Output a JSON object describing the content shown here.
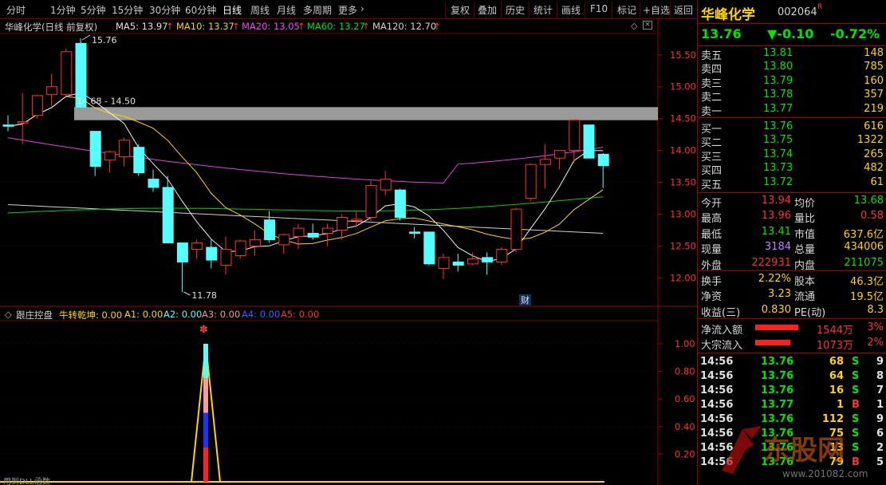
{
  "toolbar": {
    "periods": [
      "分时",
      "1分钟",
      "5分钟",
      "15分钟",
      "30分钟",
      "60分钟",
      "日线",
      "周线",
      "月线",
      "多周期",
      "更多"
    ],
    "active": "日线",
    "actions": [
      "复权",
      "叠加",
      "历史",
      "统计",
      "画线",
      "F10",
      "标记",
      "+自选",
      "返回"
    ]
  },
  "chart_info": {
    "title": "华峰化学(日线 前复权)",
    "ma5": "MA5: 13.97",
    "ma10": "MA10: 13.37",
    "ma20": "MA20: 13.05",
    "ma60": "MA60: 13.27",
    "ma120": "MA120: 12.70",
    "arrow": "↑"
  },
  "price_axis": [
    "15.50",
    "15.00",
    "14.50",
    "14.00",
    "13.50",
    "13.00",
    "12.50",
    "12.00"
  ],
  "annotations": {
    "high": "15.76",
    "low": "11.78",
    "zone": "14.68 - 14.50",
    "fin": "财"
  },
  "indicator": {
    "name": "跟庄控盘",
    "line_name": "牛转乾坤: 0.00",
    "a1": "A1: 0.00",
    "a2": "A2: 0.00",
    "a3": "A3: 0.00",
    "a4": "A4: 0.00",
    "a5": "A5: 0.00",
    "axis": [
      "1.00",
      "0.80",
      "0.60",
      "0.40",
      "0.20"
    ]
  },
  "bottom_text": "用到DLL函数",
  "stock": {
    "name": "华峰化学",
    "code": "002064",
    "flag": "R",
    "price": "13.76",
    "change": "▼-0.10",
    "pct": "-0.72%"
  },
  "asks": [
    {
      "label": "卖五",
      "price": "13.81",
      "vol": "148"
    },
    {
      "label": "卖四",
      "price": "13.80",
      "vol": "785"
    },
    {
      "label": "卖三",
      "price": "13.79",
      "vol": "160"
    },
    {
      "label": "卖二",
      "price": "13.78",
      "vol": "357"
    },
    {
      "label": "卖一",
      "price": "13.77",
      "vol": "219"
    }
  ],
  "bids": [
    {
      "label": "买一",
      "price": "13.76",
      "vol": "616"
    },
    {
      "label": "买二",
      "price": "13.75",
      "vol": "1322"
    },
    {
      "label": "买三",
      "price": "13.74",
      "vol": "265"
    },
    {
      "label": "买四",
      "price": "13.73",
      "vol": "482"
    },
    {
      "label": "买五",
      "price": "13.72",
      "vol": "61"
    }
  ],
  "quote": [
    {
      "l1": "今开",
      "v1": "13.94",
      "l2": "均价",
      "v2": "13.68"
    },
    {
      "l1": "最高",
      "v1": "13.96",
      "l2": "量比",
      "v2": "0.58"
    },
    {
      "l1": "最低",
      "v1": "13.41",
      "l2": "市值",
      "v2": "637.6亿"
    },
    {
      "l1": "现量",
      "v1": "3184",
      "l2": "总量",
      "v2": "434006"
    },
    {
      "l1": "外盘",
      "v1": "222931",
      "l2": "内盘",
      "v2": "211075"
    }
  ],
  "quote2": [
    {
      "l1": "换手",
      "v1": "2.22%",
      "l2": "股本",
      "v2": "46.3亿"
    },
    {
      "l1": "净资",
      "v1": "3.23",
      "l2": "流通",
      "v2": "19.5亿"
    },
    {
      "l1": "收益(三)",
      "v1": "0.830",
      "l2": "PE(动)",
      "v2": "8.3"
    }
  ],
  "flows": [
    {
      "label": "净流入额",
      "value": "1544万",
      "pct": "3%"
    },
    {
      "label": "大宗流入",
      "value": "1073万",
      "pct": "2%"
    }
  ],
  "ticks": [
    {
      "time": "14:56",
      "price": "13.76",
      "vol": "68",
      "bs": "S",
      "n": "9"
    },
    {
      "time": "14:56",
      "price": "13.76",
      "vol": "64",
      "bs": "S",
      "n": "8"
    },
    {
      "time": "14:56",
      "price": "13.76",
      "vol": "16",
      "bs": "S",
      "n": "7"
    },
    {
      "time": "14:56",
      "price": "13.77",
      "vol": "1",
      "bs": "B",
      "n": "1"
    },
    {
      "time": "14:56",
      "price": "13.76",
      "vol": "112",
      "bs": "S",
      "n": "9"
    },
    {
      "time": "14:56",
      "price": "13.76",
      "vol": "75",
      "bs": "S",
      "n": "6"
    },
    {
      "time": "14:56",
      "price": "13.76",
      "vol": "13",
      "bs": "S",
      "n": "2"
    },
    {
      "time": "14:56",
      "price": "13.76",
      "vol": "79",
      "bs": "B",
      "n": "5"
    }
  ],
  "candles": [
    {
      "o": 14.4,
      "h": 14.55,
      "l": 14.3,
      "c": 14.38
    },
    {
      "o": 14.45,
      "h": 14.9,
      "l": 14.1,
      "c": 14.45
    },
    {
      "o": 14.55,
      "h": 14.88,
      "l": 14.5,
      "c": 14.86
    },
    {
      "o": 14.88,
      "h": 15.2,
      "l": 14.7,
      "c": 15.0
    },
    {
      "o": 14.88,
      "h": 15.6,
      "l": 14.85,
      "c": 15.55
    },
    {
      "o": 15.68,
      "h": 15.76,
      "l": 14.68,
      "c": 14.68
    },
    {
      "o": 14.3,
      "h": 14.3,
      "l": 13.6,
      "c": 13.75
    },
    {
      "o": 13.85,
      "h": 14.0,
      "l": 13.65,
      "c": 13.98
    },
    {
      "o": 13.9,
      "h": 14.2,
      "l": 13.75,
      "c": 14.16
    },
    {
      "o": 14.05,
      "h": 14.1,
      "l": 13.6,
      "c": 13.65
    },
    {
      "o": 13.55,
      "h": 13.7,
      "l": 13.35,
      "c": 13.42
    },
    {
      "o": 13.42,
      "h": 13.6,
      "l": 12.55,
      "c": 12.55
    },
    {
      "o": 12.55,
      "h": 12.55,
      "l": 11.78,
      "c": 12.25
    },
    {
      "o": 12.45,
      "h": 12.6,
      "l": 12.3,
      "c": 12.55
    },
    {
      "o": 12.48,
      "h": 12.6,
      "l": 12.15,
      "c": 12.28
    },
    {
      "o": 12.2,
      "h": 12.65,
      "l": 12.05,
      "c": 12.45
    },
    {
      "o": 12.35,
      "h": 12.6,
      "l": 12.3,
      "c": 12.58
    },
    {
      "o": 12.5,
      "h": 12.75,
      "l": 12.35,
      "c": 12.6
    },
    {
      "o": 12.91,
      "h": 13.05,
      "l": 12.55,
      "c": 12.6
    },
    {
      "o": 12.52,
      "h": 12.7,
      "l": 12.38,
      "c": 12.68
    },
    {
      "o": 12.65,
      "h": 12.85,
      "l": 12.45,
      "c": 12.78
    },
    {
      "o": 12.7,
      "h": 12.85,
      "l": 12.6,
      "c": 12.64
    },
    {
      "o": 12.7,
      "h": 12.85,
      "l": 12.5,
      "c": 12.78
    },
    {
      "o": 12.75,
      "h": 13.0,
      "l": 12.6,
      "c": 12.95
    },
    {
      "o": 12.9,
      "h": 13.05,
      "l": 12.8,
      "c": 12.92
    },
    {
      "o": 12.95,
      "h": 13.52,
      "l": 12.9,
      "c": 13.45
    },
    {
      "o": 13.38,
      "h": 13.68,
      "l": 13.3,
      "c": 13.55
    },
    {
      "o": 13.38,
      "h": 13.4,
      "l": 12.9,
      "c": 12.95
    },
    {
      "o": 12.72,
      "h": 12.8,
      "l": 12.62,
      "c": 12.7
    },
    {
      "o": 12.72,
      "h": 12.72,
      "l": 12.2,
      "c": 12.22
    },
    {
      "o": 12.15,
      "h": 12.38,
      "l": 11.98,
      "c": 12.32
    },
    {
      "o": 12.25,
      "h": 12.38,
      "l": 12.1,
      "c": 12.2
    },
    {
      "o": 12.22,
      "h": 12.4,
      "l": 12.2,
      "c": 12.3
    },
    {
      "o": 12.32,
      "h": 12.4,
      "l": 12.05,
      "c": 12.25
    },
    {
      "o": 12.25,
      "h": 12.48,
      "l": 12.2,
      "c": 12.45
    },
    {
      "o": 12.45,
      "h": 13.1,
      "l": 12.4,
      "c": 13.08
    },
    {
      "o": 13.25,
      "h": 13.8,
      "l": 13.2,
      "c": 13.78
    },
    {
      "o": 13.78,
      "h": 14.1,
      "l": 13.4,
      "c": 13.86
    },
    {
      "o": 13.88,
      "h": 14.0,
      "l": 13.7,
      "c": 14.0
    },
    {
      "o": 14.0,
      "h": 14.48,
      "l": 13.8,
      "c": 14.48
    },
    {
      "o": 14.4,
      "h": 14.4,
      "l": 13.88,
      "c": 13.88
    },
    {
      "o": 13.94,
      "h": 13.96,
      "l": 13.41,
      "c": 13.76
    }
  ]
}
